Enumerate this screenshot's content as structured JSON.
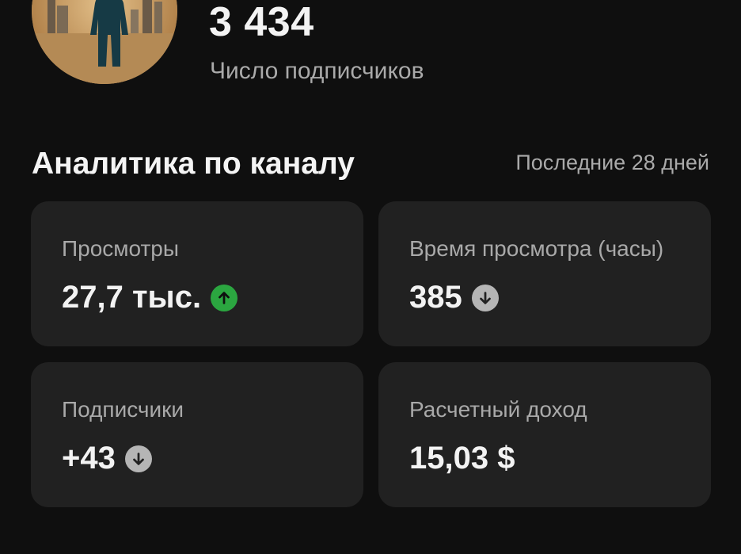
{
  "channel": {
    "subscriber_count": "3 434",
    "subscriber_label": "Число подписчиков"
  },
  "analytics": {
    "title": "Аналитика по каналу",
    "period": "Последние 28 дней",
    "cards": [
      {
        "label": "Просмотры",
        "value": "27,7 тыс.",
        "trend": "up",
        "trend_icon": "arrow-up-icon",
        "trend_color": "#2ba640"
      },
      {
        "label": "Время просмотра (часы)",
        "value": "385",
        "trend": "down",
        "trend_icon": "arrow-down-icon",
        "trend_color": "#b5b5b5"
      },
      {
        "label": "Подписчики",
        "value": "+43",
        "trend": "down",
        "trend_icon": "arrow-down-icon",
        "trend_color": "#b5b5b5"
      },
      {
        "label": "Расчетный доход",
        "value": "15,03 $"
      }
    ]
  },
  "colors": {
    "background": "#0f0f0f",
    "card": "#212121",
    "primary_text": "#f1f1f1",
    "secondary_text": "#aaaaaa"
  }
}
